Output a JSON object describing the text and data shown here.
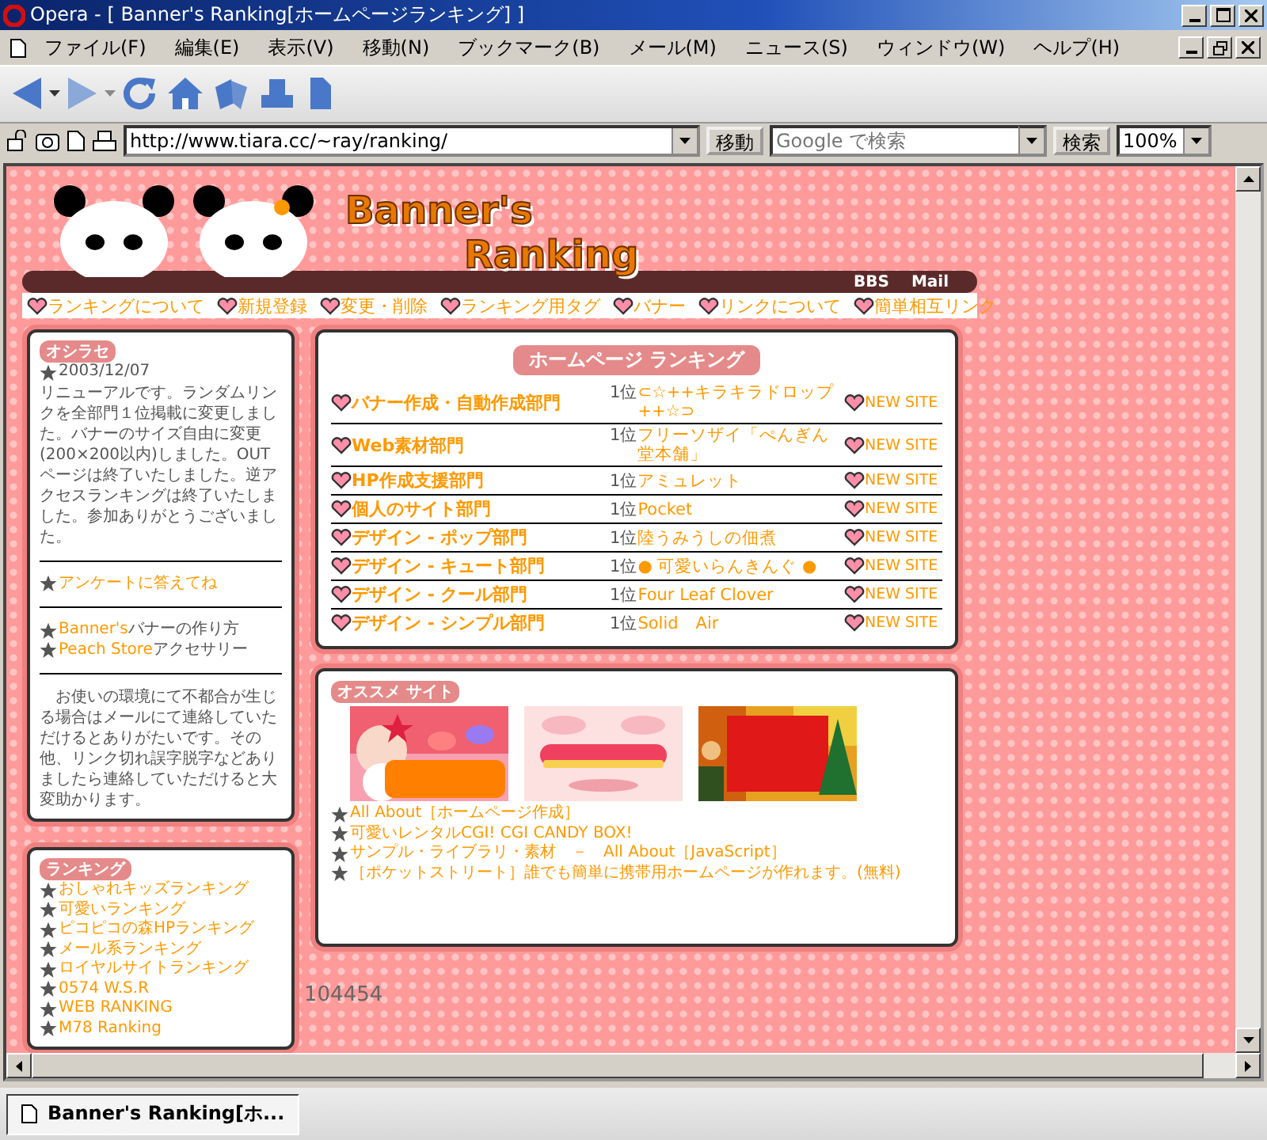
{
  "window": {
    "title": "Opera - [ Banner's Ranking[ホームページランキング] ]"
  },
  "menu": [
    "ファイル(F)",
    "編集(E)",
    "表示(V)",
    "移動(N)",
    "ブックマーク(B)",
    "メール(M)",
    "ニュース(S)",
    "ウィンドウ(W)",
    "ヘルプ(H)"
  ],
  "address_bar": {
    "url": "http://www.tiara.cc/~ray/ranking/",
    "go_button": "移動",
    "search": {
      "placeholder": "Google で検索"
    },
    "search_button": "検索",
    "zoom": "100%"
  },
  "page": {
    "logo": {
      "line1": "Banner's",
      "line2": "Ranking"
    },
    "header_links": [
      "BBS",
      "Mail"
    ],
    "nav": [
      "ランキングについて",
      "新規登録",
      "変更・削除",
      "ランキング用タグ",
      "バナー",
      "リンクについて",
      "簡単相互リンク"
    ],
    "notice": {
      "heading": "オシラセ",
      "date": "2003/12/07",
      "body": "リニューアルです。ランダムリンクを全部門１位掲載に変更しました。バナーのサイズ自由に変更(200×200以内)しました。OUTページは終了いたしました。逆アクセスランキングは終了いたしました。参加ありがとうございました。",
      "survey_link": "アンケートに答えてね",
      "links": [
        {
          "link": "Banner's",
          "text": "バナーの作り方"
        },
        {
          "link": "Peach Store",
          "text": "アクセサリー"
        }
      ],
      "footer": "お使いの環境にて不都合が生じる場合はメールにて連絡していただけるとありがたいです。その他、リンク切れ誤字脱字などありましたら連絡していただけると大変助かります。"
    },
    "rankings": {
      "heading": "ランキング",
      "items": [
        "おしゃれキッズランキング",
        "可愛いランキング",
        "ピコピコの森HPランキング",
        "メール系ランキング",
        "ロイヤルサイトランキング",
        "0574 W.S.R",
        "WEB RANKING",
        "M78 Ranking"
      ]
    },
    "ranking_table": {
      "heading": "ホームページ ランキング",
      "rows": [
        {
          "category": "バナー作成・自動作成部門",
          "rank": "1位",
          "site": "⊂☆++キラキラドロップ++☆⊃",
          "badge": "NEW SITE"
        },
        {
          "category": "Web素材部門",
          "rank": "1位",
          "site": "フリーソザイ「ぺんぎん堂本舗」",
          "badge": "NEW SITE"
        },
        {
          "category": "HP作成支援部門",
          "rank": "1位",
          "site": "アミュレット",
          "badge": "NEW SITE"
        },
        {
          "category": "個人のサイト部門",
          "rank": "1位",
          "site": "Pocket",
          "badge": "NEW SITE"
        },
        {
          "category": "デザイン - ポップ部門",
          "rank": "1位",
          "site": "陸うみうしの佃煮",
          "badge": "NEW SITE"
        },
        {
          "category": "デザイン - キュート部門",
          "rank": "1位",
          "site": "● 可愛いらんきんぐ ●",
          "badge": "NEW SITE"
        },
        {
          "category": "デザイン - クール部門",
          "rank": "1位",
          "site": "Four Leaf Clover",
          "badge": "NEW SITE"
        },
        {
          "category": "デザイン - シンプル部門",
          "rank": "1位",
          "site": "Solid　Air",
          "badge": "NEW SITE"
        }
      ]
    },
    "recommended": {
      "heading": "オススメ サイト",
      "links": [
        "All About［ホームページ作成］",
        "可愛いレンタルCGI!  CGI CANDY BOX!",
        "サンプル・ライブラリ・素材　－　All About［JavaScript］",
        "［ポケットストリート］誰でも簡単に携帯用ホームページが作れます。(無料)"
      ]
    },
    "counter": "104454"
  },
  "tab_bar": {
    "tabs": [
      {
        "label": "Banner's Ranking[ホ...",
        "selected": true
      }
    ]
  }
}
